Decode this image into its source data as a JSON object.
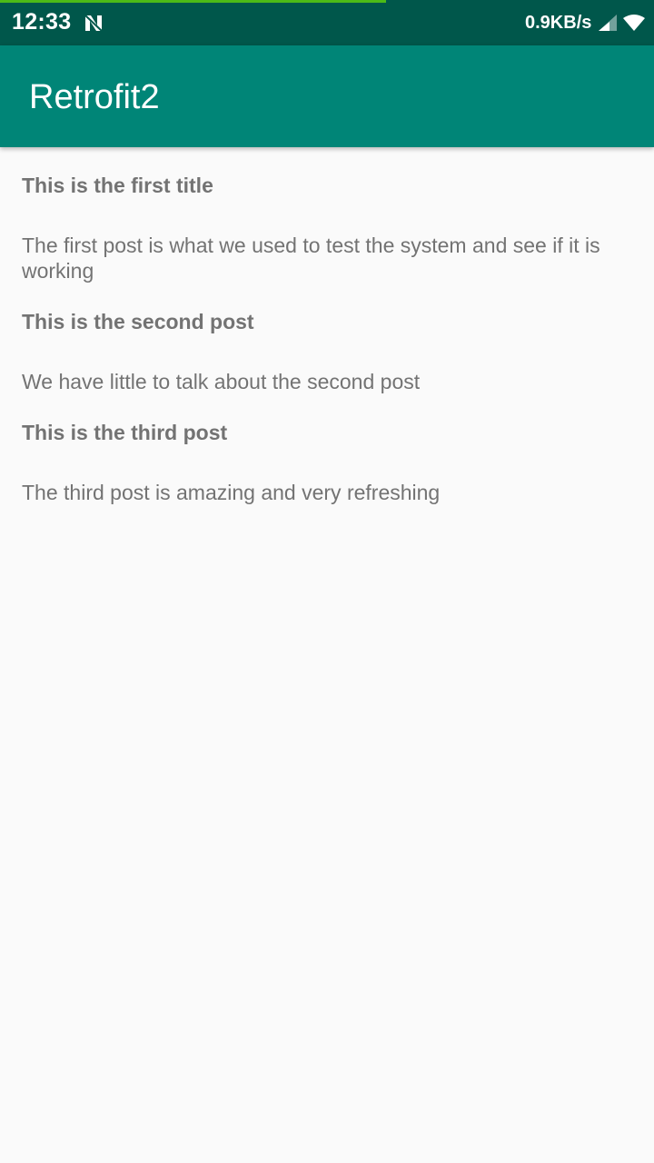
{
  "status_bar": {
    "time": "12:33",
    "n_icon": "n-notification-icon",
    "net_speed": "0.9KB/s",
    "signal_icon": "cell-signal-icon",
    "wifi_icon": "wifi-icon",
    "progress_fraction": 0.59,
    "bg_color": "#00574b",
    "progress_color": "#4cbb17"
  },
  "app_bar": {
    "title": "Retrofit2",
    "bg_color": "#008577"
  },
  "posts": [
    {
      "title": "This is the first title",
      "body": "The first post is what we used to test the system and see if it is working"
    },
    {
      "title": "This is the second post",
      "body": "We have little to talk about the second post"
    },
    {
      "title": "This is the third post",
      "body": "The third post is amazing and very refreshing"
    }
  ]
}
